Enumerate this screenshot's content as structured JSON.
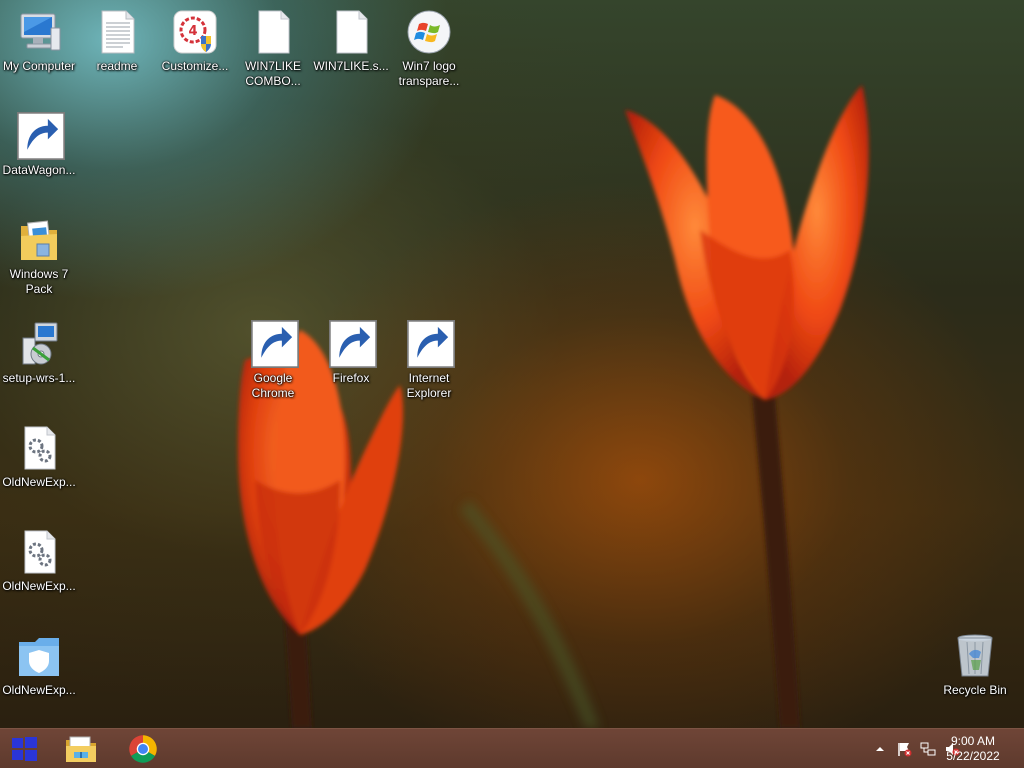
{
  "desktop": {
    "icons": [
      {
        "label": "My Computer",
        "icon": "computer-icon",
        "shortcut": false
      },
      {
        "label": "readme",
        "icon": "text-file-icon",
        "shortcut": false
      },
      {
        "label": "Customize...",
        "icon": "customize-shield-icon",
        "shortcut": false
      },
      {
        "label": "WIN7LIKE\nCOMBO...",
        "icon": "blank-file-icon",
        "shortcut": false
      },
      {
        "label": "WIN7LIKE.s...",
        "icon": "blank-file-icon",
        "shortcut": false
      },
      {
        "label": "Win7 logo\ntranspare...",
        "icon": "windows7-logo-icon",
        "shortcut": false
      },
      {
        "label": "DataWagon...",
        "icon": "datawagon-icon",
        "shortcut": true
      },
      {
        "label": "Windows 7\nPack",
        "icon": "folder-icon",
        "shortcut": false
      },
      {
        "label": "setup-wrs-1...",
        "icon": "setup-installer-icon",
        "shortcut": false
      },
      {
        "label": "Google\nChrome",
        "icon": "chrome-icon",
        "shortcut": true
      },
      {
        "label": "Firefox",
        "icon": "firefox-icon",
        "shortcut": true
      },
      {
        "label": "Internet\nExplorer",
        "icon": "internet-explorer-icon",
        "shortcut": true
      },
      {
        "label": "OldNewExp...",
        "icon": "config-file-icon",
        "shortcut": false
      },
      {
        "label": "OldNewExp...",
        "icon": "config-file-icon",
        "shortcut": false
      },
      {
        "label": "OldNewExp...",
        "icon": "shield-file-icon",
        "shortcut": false
      },
      {
        "label": "Recycle Bin",
        "icon": "recycle-bin-icon",
        "shortcut": false
      }
    ]
  },
  "taskbar": {
    "start_icon": "windows-start-icon",
    "pinned": [
      {
        "icon": "file-explorer-icon"
      },
      {
        "icon": "chrome-icon"
      }
    ],
    "tray": {
      "icons": [
        "show-hidden-icons-chevron",
        "action-center-flag-icon",
        "network-icon",
        "volume-muted-icon"
      ],
      "time": "9:00 AM",
      "date": "5/22/2022"
    }
  }
}
